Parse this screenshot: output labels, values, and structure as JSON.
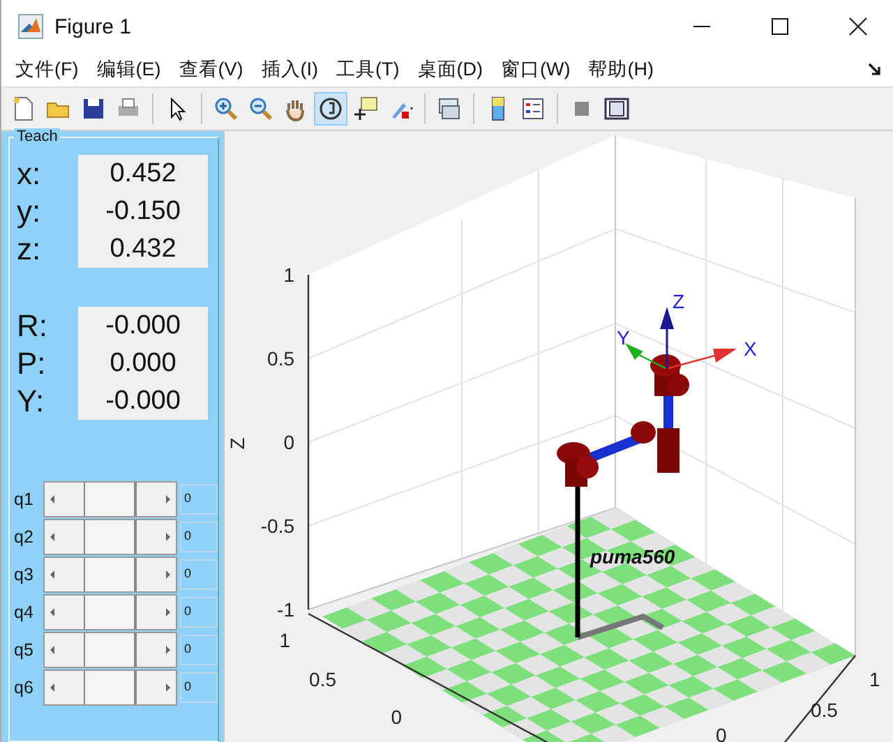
{
  "window": {
    "title": "Figure 1"
  },
  "menu": [
    "文件(F)",
    "编辑(E)",
    "查看(V)",
    "插入(I)",
    "工具(T)",
    "桌面(D)",
    "窗口(W)",
    "帮助(H)"
  ],
  "toolbar": [
    {
      "selected": false
    },
    {
      "selected": false
    },
    {
      "selected": false
    },
    {
      "selected": false
    },
    {
      "selected": false
    },
    {
      "selected": false
    },
    {
      "selected": false
    },
    {
      "selected": false
    },
    {
      "selected": true
    },
    {
      "selected": false
    },
    {
      "selected": false
    },
    {
      "selected": false
    },
    {
      "selected": false
    },
    {
      "selected": false
    },
    {
      "selected": false
    },
    {
      "selected": false
    }
  ],
  "teach": {
    "title": "Teach",
    "position": [
      {
        "label": "x:",
        "value": "0.452"
      },
      {
        "label": "y:",
        "value": "-0.150"
      },
      {
        "label": "z:",
        "value": "0.432"
      }
    ],
    "orientation": [
      {
        "label": "R:",
        "value": "-0.000"
      },
      {
        "label": "P:",
        "value": "0.000"
      },
      {
        "label": "Y:",
        "value": "-0.000"
      }
    ],
    "joints": [
      {
        "label": "q1",
        "value": "0",
        "level": 0.5
      },
      {
        "label": "q2",
        "value": "0",
        "level": 0.5
      },
      {
        "label": "q3",
        "value": "0",
        "level": 0.5
      },
      {
        "label": "q4",
        "value": "0",
        "level": 0.5
      },
      {
        "label": "q5",
        "value": "0",
        "level": 0.5
      },
      {
        "label": "q6",
        "value": "0",
        "level": 0.5
      }
    ]
  },
  "plot": {
    "z_label": "Z",
    "z_ticks": [
      "1",
      "0.5",
      "0",
      "-0.5",
      "-1"
    ],
    "y_ticks": [
      "1",
      "0.5",
      "0"
    ],
    "x_ticks": [
      "1",
      "0.5",
      "0"
    ],
    "robot_name": "puma560",
    "frame_labels": [
      "X",
      "Y",
      "Z"
    ]
  }
}
